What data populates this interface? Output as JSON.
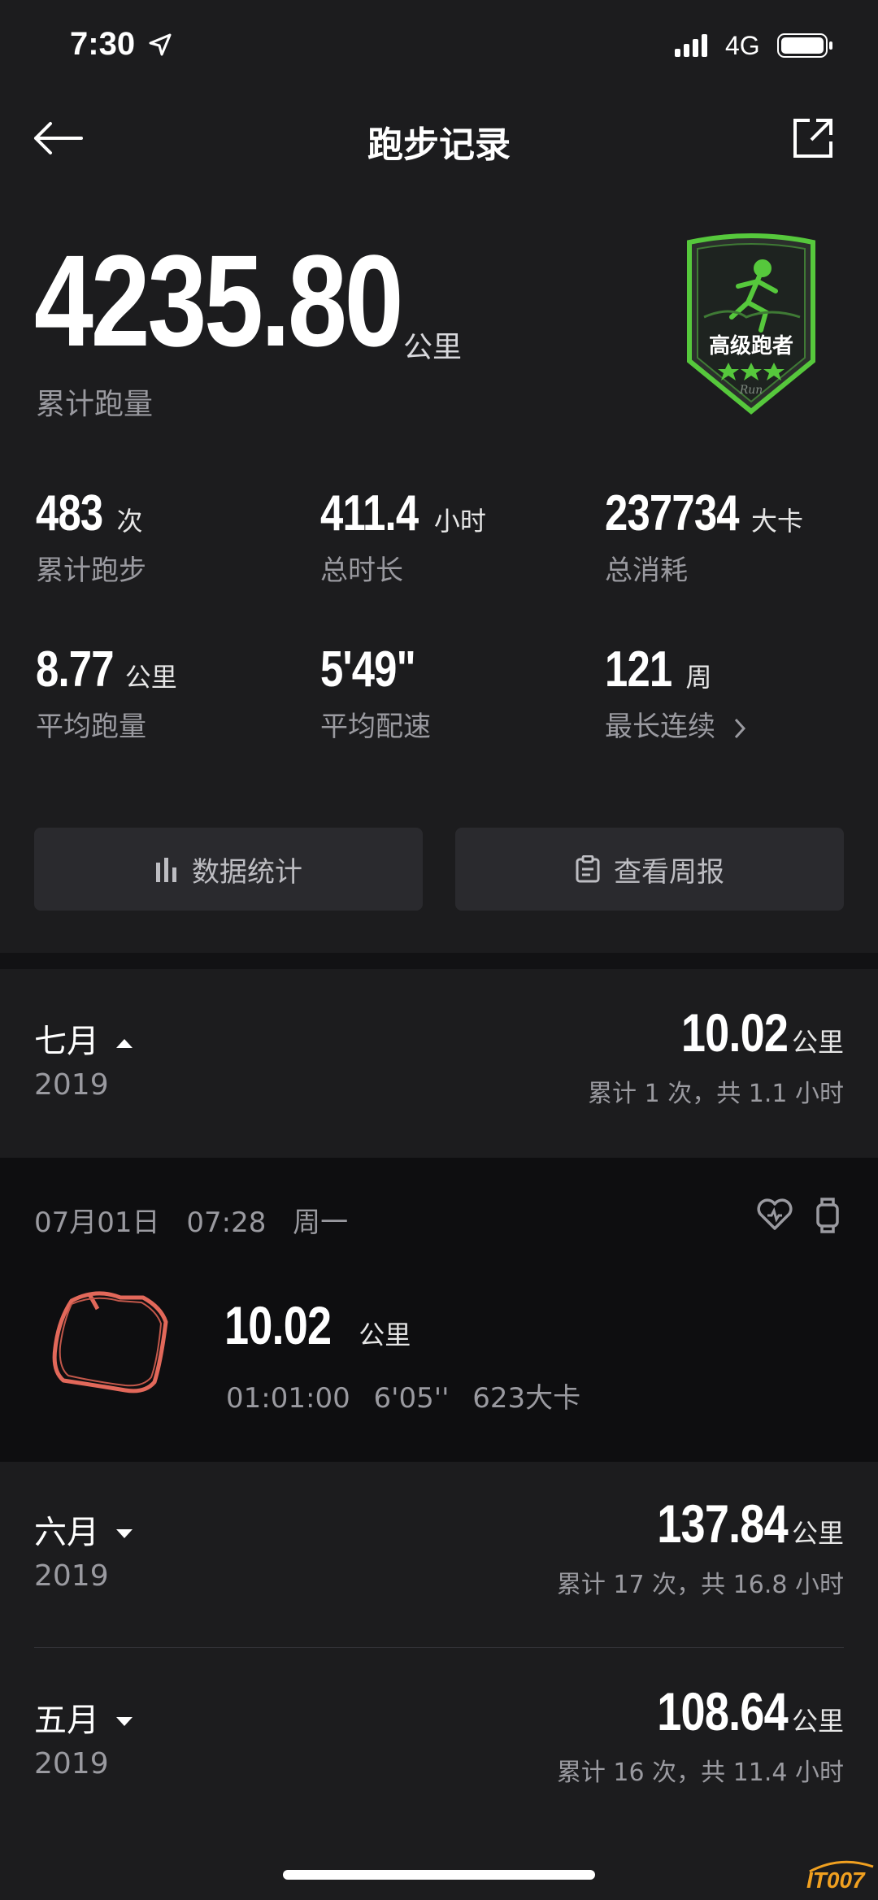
{
  "status_bar": {
    "time": "7:30",
    "network": "4G"
  },
  "header": {
    "title": "跑步记录"
  },
  "total": {
    "value": "4235.80",
    "unit": "公里",
    "label": "累计跑量"
  },
  "badge": {
    "title": "高级跑者",
    "sub": "Run"
  },
  "stats": [
    {
      "value": "483",
      "unit": "次",
      "label": "累计跑步"
    },
    {
      "value": "411.4",
      "unit": "小时",
      "label": "总时长"
    },
    {
      "value": "237734",
      "unit": "大卡",
      "label": "总消耗"
    },
    {
      "value": "8.77",
      "unit": "公里",
      "label": "平均跑量"
    },
    {
      "value": "5'49\"",
      "unit": "",
      "label": "平均配速"
    },
    {
      "value": "121",
      "unit": "周",
      "label": "最长连续"
    }
  ],
  "buttons": {
    "stats": "数据统计",
    "weekly": "查看周报"
  },
  "months": [
    {
      "month": "七月",
      "year": "2019",
      "distance": "10.02",
      "unit": "公里",
      "summary": "累计 1 次，共 1.1 小时"
    },
    {
      "month": "六月",
      "year": "2019",
      "distance": "137.84",
      "unit": "公里",
      "summary": "累计 17 次，共 16.8 小时"
    },
    {
      "month": "五月",
      "year": "2019",
      "distance": "108.64",
      "unit": "公里",
      "summary": "累计 16 次，共 11.4 小时"
    }
  ],
  "run": {
    "date": "07月01日",
    "time": "07:28",
    "weekday": "周一",
    "distance": "10.02",
    "unit": "公里",
    "duration": "01:01:00",
    "pace": "6'05''",
    "calories": "623大卡"
  },
  "watermark": "IT007",
  "colors": {
    "accent": "#56c83c",
    "route": "#e2685a",
    "background": "#1c1c1e"
  }
}
